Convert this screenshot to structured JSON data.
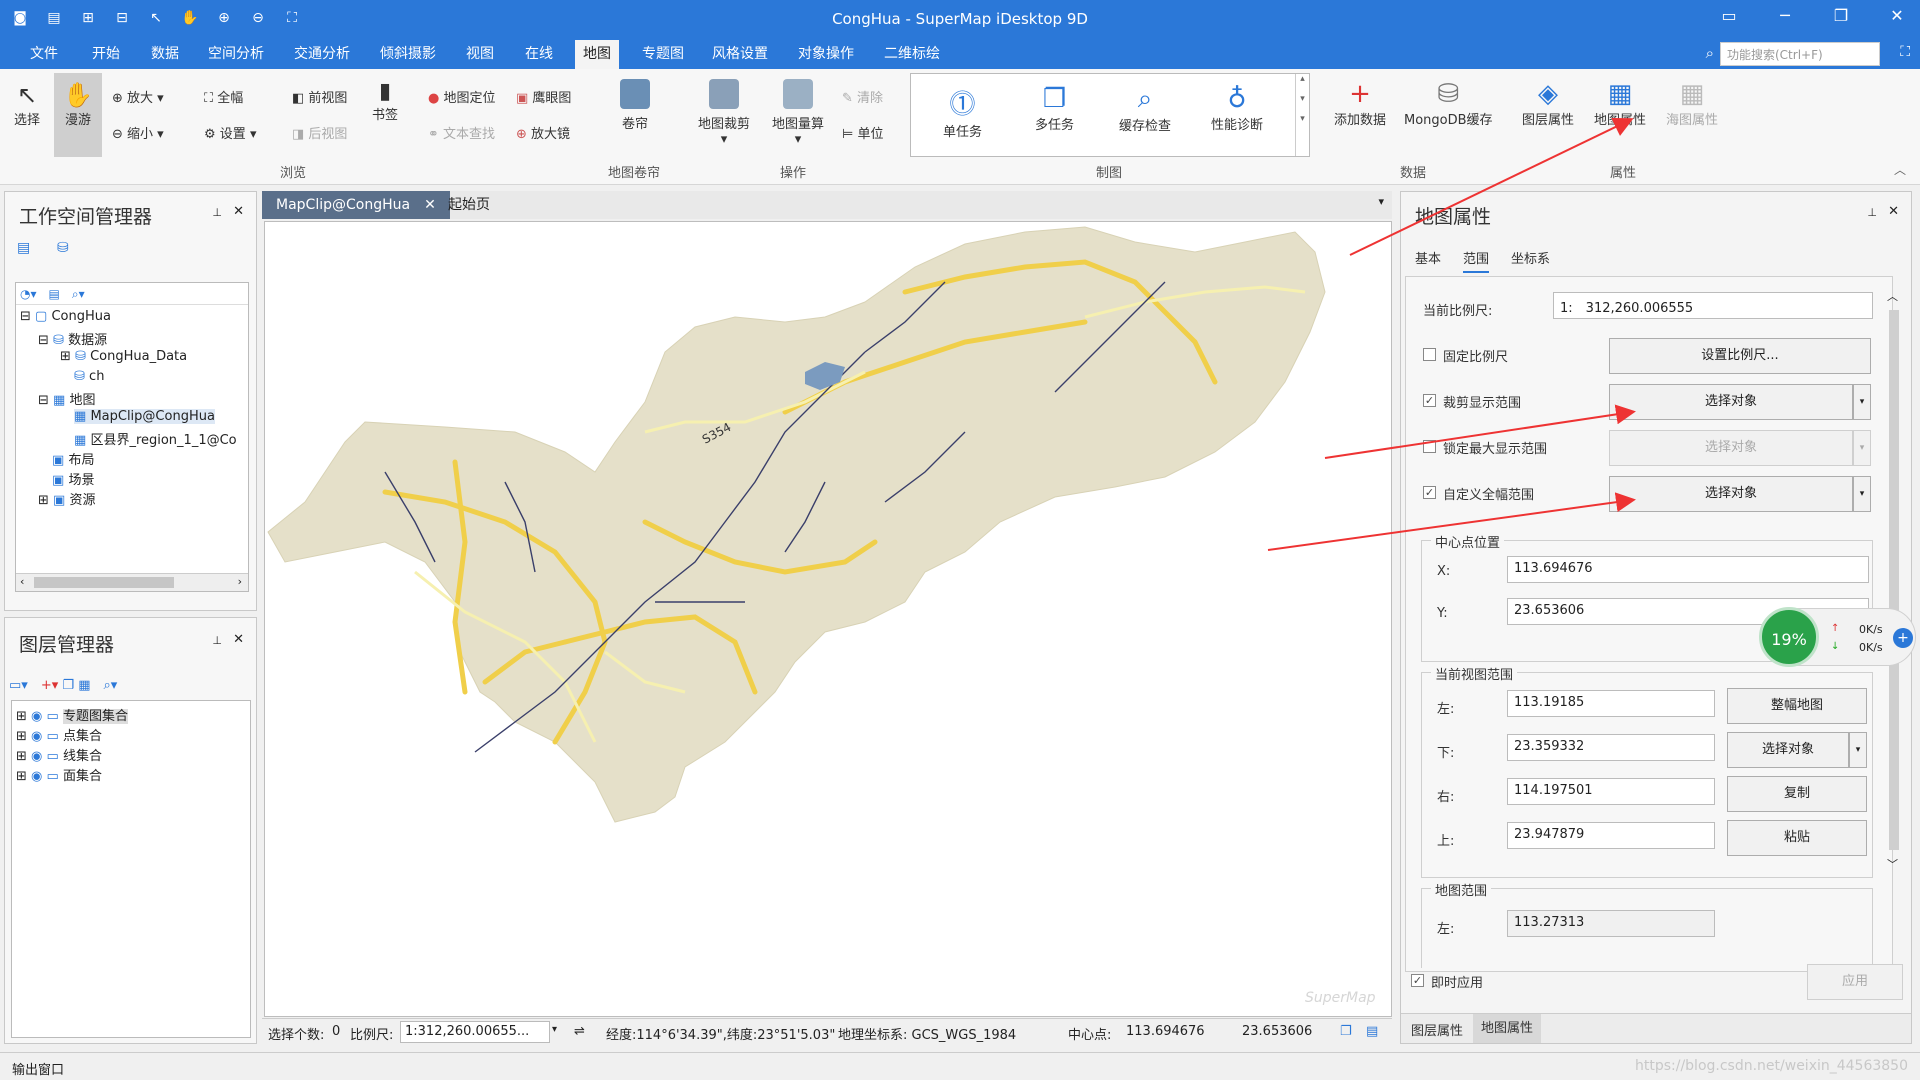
{
  "app": {
    "title": "CongHua - SuperMap iDesktop 9D"
  },
  "menu": [
    "文件",
    "开始",
    "数据",
    "空间分析",
    "交通分析",
    "倾斜摄影",
    "视图",
    "在线",
    "地图",
    "专题图",
    "风格设置",
    "对象操作",
    "二维标绘"
  ],
  "search": {
    "placeholder": "功能搜索(Ctrl+F)"
  },
  "ribbon": {
    "select": "选择",
    "pan": "漫游",
    "zoom_in": "放大",
    "zoom_out": "缩小",
    "full": "全幅",
    "settings": "设置",
    "prev_view": "前视图",
    "next_view": "后视图",
    "bookmark": "书签",
    "locate": "地图定位",
    "text_find": "文本查找",
    "eagle": "鹰眼图",
    "magnifier": "放大镜",
    "scroll": "卷帘",
    "clip": "地图裁剪",
    "measure": "地图量算",
    "clear": "清除",
    "unit": "单位",
    "single_task": "单任务",
    "multi_task": "多任务",
    "cache_check": "缓存检查",
    "perf_diag": "性能诊断",
    "add_data": "添加数据",
    "mongo_cache": "MongoDB缓存",
    "layer_props": "图层属性",
    "map_props": "地图属性",
    "chart_props": "海图属性",
    "groups": {
      "browse": "浏览",
      "scroll": "地图卷帘",
      "ops": "操作",
      "draw": "制图",
      "data": "数据",
      "props": "属性"
    }
  },
  "workspace": {
    "title": "工作空间管理器",
    "root": "CongHua",
    "datasource": "数据源",
    "ds1": "CongHua_Data",
    "ds2": "ch",
    "maps": "地图",
    "map1": "MapClip@CongHua",
    "map2": "区县界_region_1_1@Co",
    "layouts": "布局",
    "scenes": "场景",
    "resources": "资源"
  },
  "layers": {
    "title": "图层管理器",
    "items": [
      "专题图集合",
      "点集合",
      "线集合",
      "面集合"
    ]
  },
  "doc_tabs": [
    "MapClip@CongHua",
    "起始页"
  ],
  "map": {
    "road_label": "S354",
    "watermark": "SuperMap"
  },
  "status": {
    "selected_label": "选择个数:",
    "selected": "0",
    "scale_label": "比例尺:",
    "scale": "1:312,260.00655...",
    "coords": "经度:114°6'34.39\",纬度:23°51'5.03\"",
    "crs": "地理坐标系: GCS_WGS_1984",
    "center_label": "中心点:",
    "cx": "113.694676",
    "cy": "23.653606"
  },
  "props": {
    "title": "地图属性",
    "tabs": [
      "基本",
      "范围",
      "坐标系"
    ],
    "current_scale_label": "当前比例尺:",
    "current_scale_prefix": "1:",
    "current_scale": "312,260.006555",
    "fixed_scale": "固定比例尺",
    "set_scale": "设置比例尺...",
    "clip_range": "裁剪显示范围",
    "lock_max": "锁定最大显示范围",
    "custom_full": "自定义全幅范围",
    "select_obj": "选择对象",
    "center_group": "中心点位置",
    "x_label": "X:",
    "x": "113.694676",
    "y_label": "Y:",
    "y": "23.653606",
    "view_group": "当前视图范围",
    "left_label": "左:",
    "left": "113.19185",
    "bottom_label": "下:",
    "bottom": "23.359332",
    "right_label": "右:",
    "right": "114.197501",
    "top_label": "上:",
    "top": "23.947879",
    "full_map": "整幅地图",
    "copy": "复制",
    "paste": "粘贴",
    "map_range_group": "地图范围",
    "map_left": "113.27313",
    "apply_now": "即时应用",
    "apply": "应用",
    "bottom_tabs": [
      "图层属性",
      "地图属性"
    ]
  },
  "monitor": {
    "percent": "19%",
    "up": "0K/s",
    "down": "0K/s"
  },
  "output": "输出窗口",
  "watermark_url": "https://blog.csdn.net/weixin_44563850"
}
